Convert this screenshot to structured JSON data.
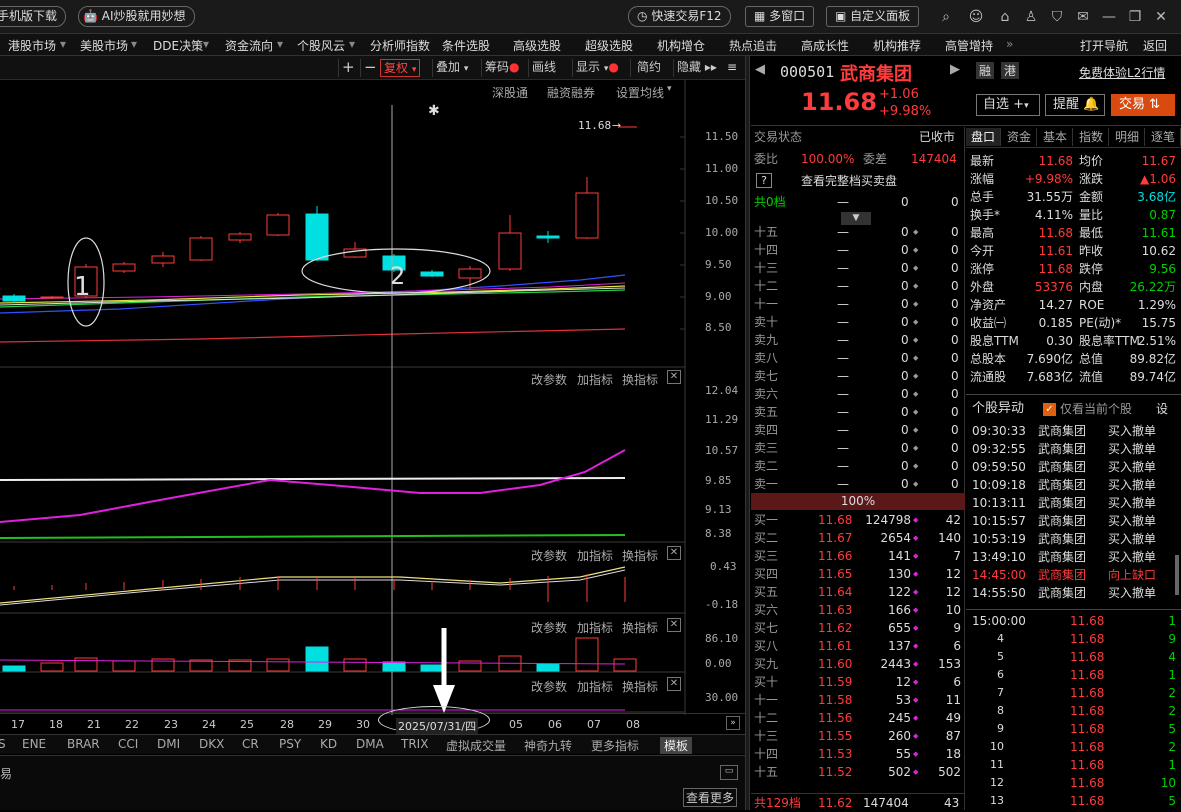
{
  "topbar": {
    "mobile_download": "手机版下载",
    "ai_label": "AI炒股就用妙想",
    "quick_trade": "快速交易F12",
    "multi_window": "多窗口",
    "custom_panel": "自定义面板"
  },
  "menu": [
    "港股市场",
    "美股市场",
    "DDE决策",
    "资金流向",
    "个股风云",
    "分析师指数",
    "条件选股",
    "高级选股",
    "超级选股",
    "机构增仓",
    "热点追击",
    "高成长性",
    "机构推荐",
    "高管增持"
  ],
  "menu_right": [
    "打开导航",
    "返回"
  ],
  "chart_toolbar": {
    "fuquan": "复权",
    "overlay": "叠加",
    "chouma": "筹码",
    "huaxian": "画线",
    "xianshi": "显示",
    "jianyue": "简约",
    "yincang": "隐藏"
  },
  "chart_subtoolbar": [
    "深股通",
    "融资融券",
    "设置均线"
  ],
  "panel_tools": [
    "改参数",
    "加指标",
    "换指标"
  ],
  "price_axis": [
    "11.50",
    "11.00",
    "10.50",
    "10.00",
    "9.50",
    "9.00",
    "8.50"
  ],
  "macd_axis": [
    "12.04",
    "11.29",
    "10.57",
    "9.85",
    "9.13",
    "8.38"
  ],
  "ind2_axis": [
    "0.43",
    "-0.18"
  ],
  "ind3_axis": [
    "86.10",
    "0.00"
  ],
  "ind4_axis": [
    "30.00"
  ],
  "last_price_tag": "11.68",
  "annotations": [
    "1",
    "2"
  ],
  "date_labels": [
    "17",
    "18",
    "21",
    "22",
    "23",
    "24",
    "25",
    "28",
    "29",
    "30",
    "31",
    "05",
    "06",
    "07",
    "08"
  ],
  "cursor_date": "2025/07/31/四",
  "indicator_tabs": [
    "S",
    "ENE",
    "BRAR",
    "CCI",
    "DMI",
    "DKX",
    "CR",
    "PSY",
    "KD",
    "DMA",
    "TRIX",
    "虚拟成交量",
    "神奇九转",
    "更多指标",
    "模板"
  ],
  "bottom": {
    "left_label": "易",
    "see_more": "查看更多"
  },
  "stock": {
    "code": "000501",
    "name": "武商集团",
    "price": "11.68",
    "change": "+1.06",
    "pct": "+9.98%",
    "tags": [
      "融",
      "港"
    ],
    "l2": "免费体验L2行情",
    "zixuan": "自选",
    "tixing": "提醒",
    "jiaoyi": "交易"
  },
  "orderbook": {
    "status_label": "交易状态",
    "status": "已收市",
    "weibi_label": "委比",
    "weibi": "100.00%",
    "weicha_label": "委差",
    "weicha": "147404",
    "full_book": "查看完整档买卖盘",
    "total_sell": "共0档",
    "sells": [
      [
        "十五",
        "—",
        "0"
      ],
      [
        "十四",
        "—",
        "0"
      ],
      [
        "十三",
        "—",
        "0"
      ],
      [
        "十二",
        "—",
        "0"
      ],
      [
        "十一",
        "—",
        "0"
      ],
      [
        "卖十",
        "—",
        "0"
      ],
      [
        "卖九",
        "—",
        "0"
      ],
      [
        "卖八",
        "—",
        "0"
      ],
      [
        "卖七",
        "—",
        "0"
      ],
      [
        "卖六",
        "—",
        "0"
      ],
      [
        "卖五",
        "—",
        "0"
      ],
      [
        "卖四",
        "—",
        "0"
      ],
      [
        "卖三",
        "—",
        "0"
      ],
      [
        "卖二",
        "—",
        "0"
      ],
      [
        "卖一",
        "—",
        "0"
      ]
    ],
    "bar_pct": "100%",
    "buys": [
      [
        "买一",
        "11.68",
        "124798",
        "42"
      ],
      [
        "买二",
        "11.67",
        "2654",
        "140"
      ],
      [
        "买三",
        "11.66",
        "141",
        "7"
      ],
      [
        "买四",
        "11.65",
        "130",
        "12"
      ],
      [
        "买五",
        "11.64",
        "122",
        "12"
      ],
      [
        "买六",
        "11.63",
        "166",
        "10"
      ],
      [
        "买七",
        "11.62",
        "655",
        "9"
      ],
      [
        "买八",
        "11.61",
        "137",
        "6"
      ],
      [
        "买九",
        "11.60",
        "2443",
        "153"
      ],
      [
        "买十",
        "11.59",
        "12",
        "6"
      ],
      [
        "十一",
        "11.58",
        "53",
        "11"
      ],
      [
        "十二",
        "11.56",
        "245",
        "49"
      ],
      [
        "十三",
        "11.55",
        "260",
        "87"
      ],
      [
        "十四",
        "11.53",
        "55",
        "18"
      ],
      [
        "十五",
        "11.52",
        "502",
        "502"
      ]
    ],
    "total_buy": [
      "共129档",
      "11.62",
      "147404",
      "43"
    ]
  },
  "pankou_tabs": [
    "盘口",
    "资金",
    "基本",
    "指数",
    "明细",
    "逐笔"
  ],
  "stats": [
    [
      "最新",
      "11.68",
      "均价",
      "11.67"
    ],
    [
      "涨幅",
      "+9.98%",
      "涨跌",
      "▲1.06"
    ],
    [
      "总手",
      "31.55万",
      "金额",
      "3.68亿"
    ],
    [
      "换手*",
      "4.11%",
      "量比",
      "0.87"
    ],
    [
      "最高",
      "11.68",
      "最低",
      "11.61"
    ],
    [
      "今开",
      "11.61",
      "昨收",
      "10.62"
    ],
    [
      "涨停",
      "11.68",
      "跌停",
      "9.56"
    ],
    [
      "外盘",
      "53376",
      "内盘",
      "26.22万"
    ],
    [
      "净资产",
      "14.27",
      "ROE",
      "1.29%"
    ],
    [
      "收益㈠",
      "0.185",
      "PE(动)*",
      "15.75"
    ],
    [
      "股息TTM",
      "0.30",
      "股息率TTM",
      "2.51%"
    ],
    [
      "总股本",
      "7.690亿",
      "总值",
      "89.82亿"
    ],
    [
      "流通股",
      "7.683亿",
      "流值",
      "89.74亿"
    ]
  ],
  "movement": {
    "title": "个股异动",
    "only_current": "仅看当前个股",
    "settings": "设",
    "rows": [
      [
        "09:30:33",
        "武商集团",
        "买入撤单"
      ],
      [
        "09:32:55",
        "武商集团",
        "买入撤单"
      ],
      [
        "09:59:50",
        "武商集团",
        "买入撤单"
      ],
      [
        "10:09:18",
        "武商集团",
        "买入撤单"
      ],
      [
        "10:13:11",
        "武商集团",
        "买入撤单"
      ],
      [
        "10:15:57",
        "武商集团",
        "买入撤单"
      ],
      [
        "10:53:19",
        "武商集团",
        "买入撤单"
      ],
      [
        "13:49:10",
        "武商集团",
        "买入撤单"
      ],
      [
        "14:45:00",
        "武商集团",
        "向上缺口"
      ],
      [
        "14:55:50",
        "武商集团",
        "买入撤单"
      ]
    ]
  },
  "ticks": [
    [
      "15:00:00",
      "11.68",
      "1"
    ],
    [
      "4",
      "11.68",
      "9"
    ],
    [
      "5",
      "11.68",
      "4"
    ],
    [
      "6",
      "11.68",
      "1"
    ],
    [
      "7",
      "11.68",
      "2"
    ],
    [
      "8",
      "11.68",
      "2"
    ],
    [
      "9",
      "11.68",
      "5"
    ],
    [
      "10",
      "11.68",
      "2"
    ],
    [
      "11",
      "11.68",
      "1"
    ],
    [
      "12",
      "11.68",
      "10"
    ],
    [
      "13",
      "11.68",
      "5"
    ]
  ],
  "colors": {
    "up": "#ff3b3b",
    "down": "#00e0e0",
    "accent": "#e06010"
  }
}
